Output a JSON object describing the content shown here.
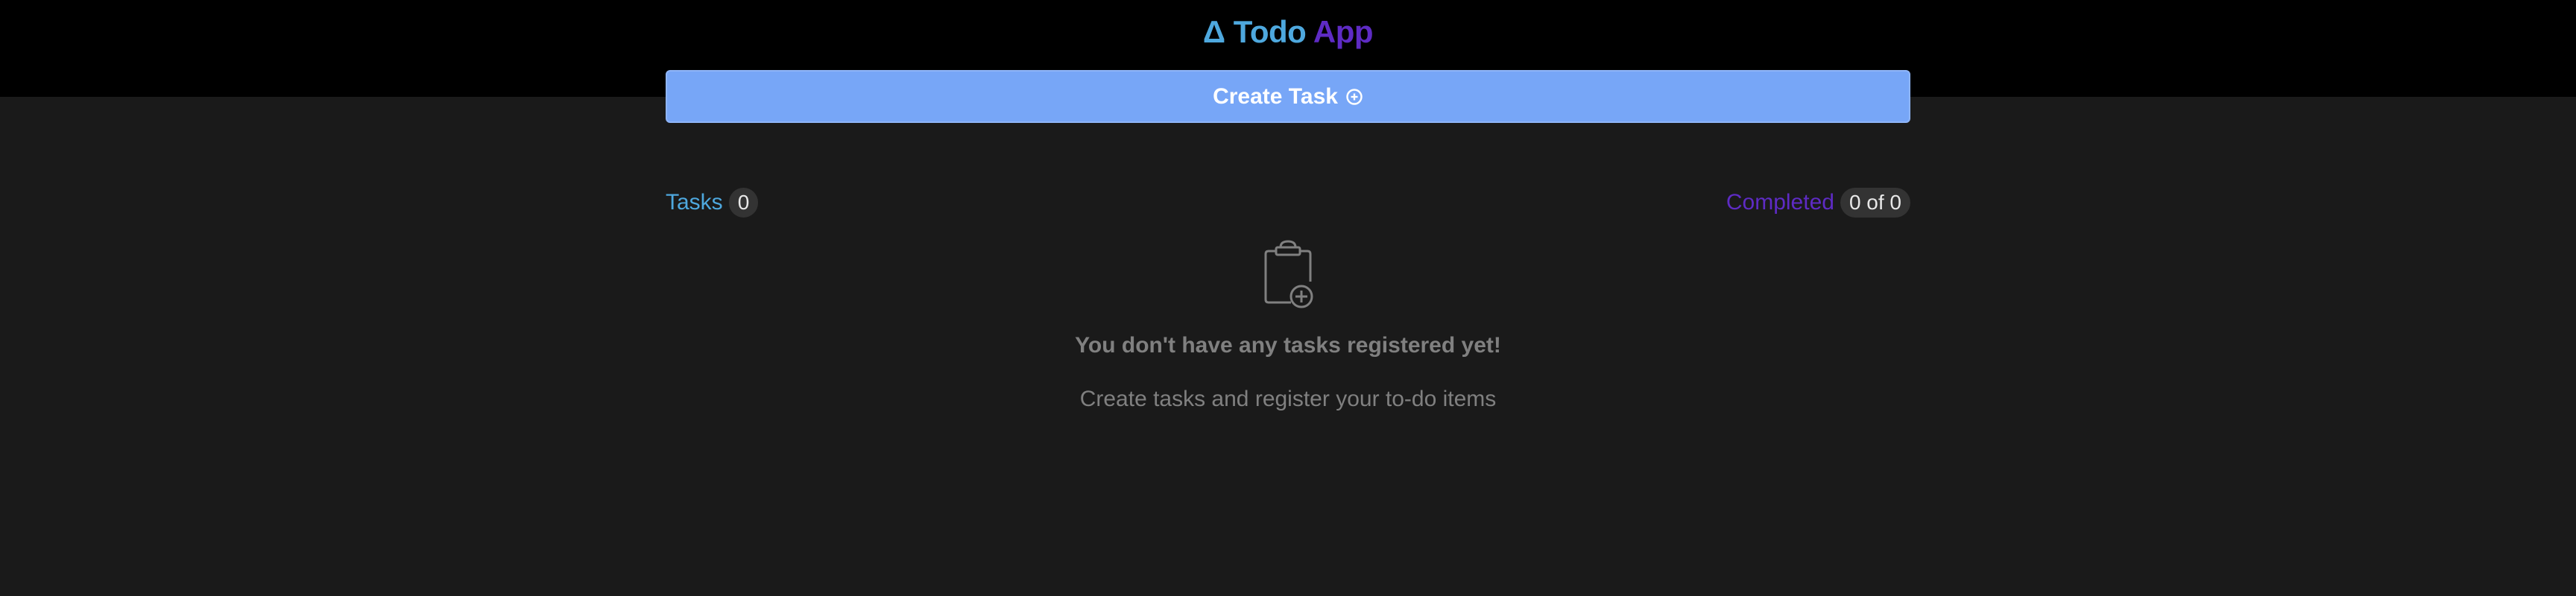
{
  "header": {
    "logo_symbol": "Δ",
    "logo_word1": "Todo",
    "logo_word2": "App"
  },
  "create_button": {
    "label": "Create Task",
    "icon": "plus-circle-icon"
  },
  "counters": {
    "tasks_label": "Tasks",
    "tasks_count": "0",
    "completed_label": "Completed",
    "completed_count": "0 of 0"
  },
  "empty_state": {
    "icon": "clipboard-plus-icon",
    "title": "You don't have any tasks registered yet!",
    "subtitle": "Create tasks and register your to-do items"
  },
  "colors": {
    "header_bg": "#000000",
    "page_bg": "#1a1a1a",
    "accent_blue": "#4ea8de",
    "accent_purple": "#5e2bc4",
    "button_bg": "#77a6f7",
    "muted_text": "#808080"
  }
}
